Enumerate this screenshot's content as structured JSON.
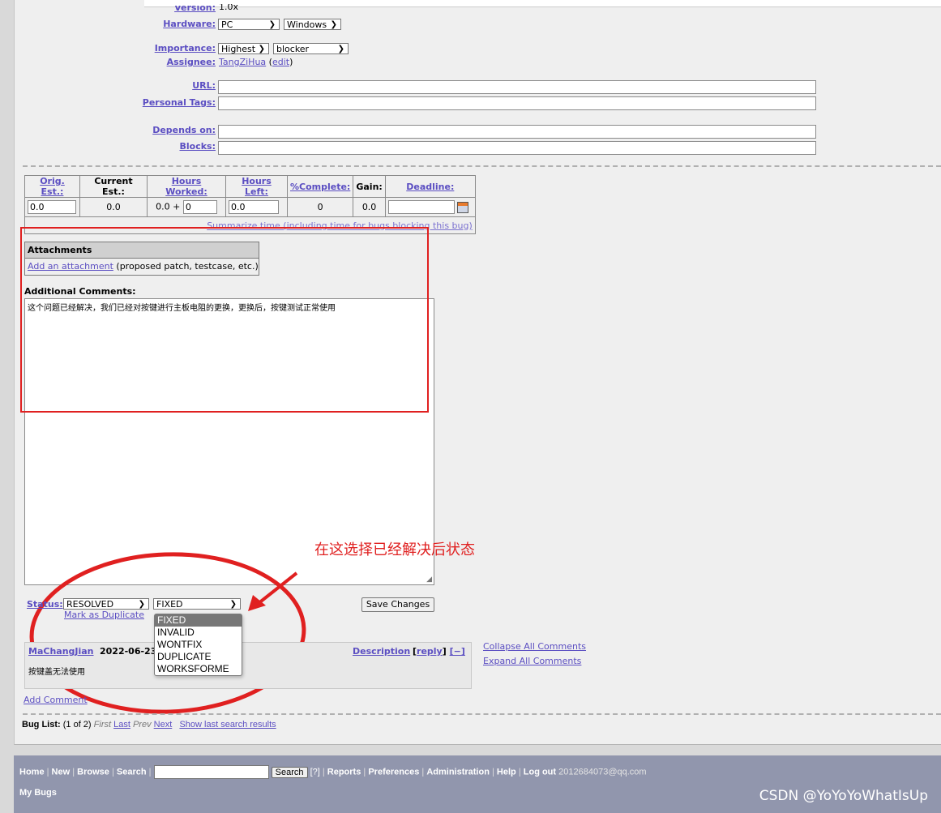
{
  "fields": {
    "version_label": "Version:",
    "version_value": "1.0x",
    "hardware_label": "Hardware:",
    "hardware_value": "PC",
    "os_value": "Windows",
    "importance_label": "Importance:",
    "priority_value": "Highest",
    "severity_value": "blocker",
    "assignee_label": "Assignee:",
    "assignee_value": "TangZiHua",
    "assignee_edit": "edit",
    "url_label": "URL:",
    "personal_tags_label": "Personal Tags:",
    "depends_on_label": "Depends on:",
    "blocks_label": "Blocks:"
  },
  "time_table": {
    "headers": [
      "Orig. Est.:",
      "Current Est.:",
      "Hours Worked:",
      "Hours Left:",
      "%Complete:",
      "Gain:",
      "Deadline:"
    ],
    "orig_est": "0.0",
    "current_est": "0.0",
    "hours_worked_prefix": "0.0 +",
    "hours_worked_input": "0",
    "hours_left": "0.0",
    "complete": "0",
    "gain": "0.0",
    "summarize_link": "Summarize time (including time for bugs blocking this bug)"
  },
  "attachments": {
    "title": "Attachments",
    "add_link": "Add an attachment",
    "add_hint": "(proposed patch, testcase, etc.)"
  },
  "comments": {
    "label": "Additional Comments:",
    "text": "这个问题已经解决，我们已经对按键进行主板电阻的更换，更换后，按键测试正常使用"
  },
  "status": {
    "label": "Status:",
    "value": "RESOLVED",
    "resolution": "FIXED",
    "mark_duplicate": "Mark as Duplicate",
    "save_button": "Save Changes",
    "resolution_options": [
      "FIXED",
      "INVALID",
      "WONTFIX",
      "DUPLICATE",
      "WORKSFORME"
    ]
  },
  "annotation": {
    "text": "在这选择已经解决后状态"
  },
  "comment_entry": {
    "author": "MaChangJian",
    "date": "2022-06-23",
    "description_link": "Description",
    "reply": "reply",
    "collapse": "[−]",
    "body": "按键盖无法使用"
  },
  "comment_controls": {
    "collapse_all": "Collapse All Comments",
    "expand_all": "Expand All Comments",
    "add_comment": "Add Comment"
  },
  "bug_list": {
    "label": "Bug List:",
    "count": "(1 of 2)",
    "first": "First",
    "last": "Last",
    "prev": "Prev",
    "next": "Next",
    "show_last": "Show last search results"
  },
  "footer": {
    "links": [
      "Home",
      "New",
      "Browse",
      "Search"
    ],
    "search_button": "Search",
    "help_q": "[?]",
    "links2": [
      "Reports",
      "Preferences",
      "Administration",
      "Help"
    ],
    "logout": "Log out",
    "user": "2012684073@qq.com",
    "my_bugs": "My Bugs"
  },
  "watermark": "CSDN @YoYoYoWhatIsUp",
  "colors": {
    "link": "#5b4ec2",
    "annotation_red": "#e02020",
    "footer_bg": "#9196ad",
    "page_bg": "#efefef"
  }
}
